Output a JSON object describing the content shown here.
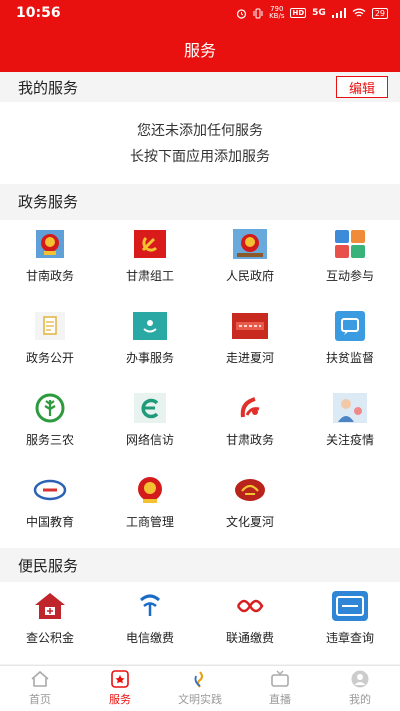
{
  "status": {
    "time": "10:56",
    "net_speed_top": "790",
    "net_speed_bottom": "KB/s",
    "hd": "HD",
    "signal": "5G",
    "battery": "29"
  },
  "header": {
    "title": "服务"
  },
  "my_services": {
    "title": "我的服务",
    "edit_label": "编辑",
    "empty_line1": "您还未添加任何服务",
    "empty_line2": "长按下面应用添加服务"
  },
  "gov_services": {
    "title": "政务服务",
    "items": [
      {
        "label": "甘南政务",
        "icon": "emblem-icon"
      },
      {
        "label": "甘肃组工",
        "icon": "party-emblem-icon"
      },
      {
        "label": "人民政府",
        "icon": "emblem-icon"
      },
      {
        "label": "互动参与",
        "icon": "grid-apps-icon"
      },
      {
        "label": "政务公开",
        "icon": "document-icon"
      },
      {
        "label": "办事服务",
        "icon": "service-icon"
      },
      {
        "label": "走进夏河",
        "icon": "banner-icon"
      },
      {
        "label": "扶贫监督",
        "icon": "chat-icon"
      },
      {
        "label": "服务三农",
        "icon": "wheat-icon"
      },
      {
        "label": "网络信访",
        "icon": "letter-e-icon"
      },
      {
        "label": "甘肃政务",
        "icon": "gansu-logo-icon"
      },
      {
        "label": "关注疫情",
        "icon": "doctor-icon"
      },
      {
        "label": "中国教育",
        "icon": "education-logo-icon"
      },
      {
        "label": "工商管理",
        "icon": "emblem-icon"
      },
      {
        "label": "文化夏河",
        "icon": "culture-logo-icon"
      }
    ]
  },
  "public_services": {
    "title": "便民服务",
    "items": [
      {
        "label": "查公积金",
        "icon": "housing-fund-icon"
      },
      {
        "label": "电信缴费",
        "icon": "china-telecom-icon"
      },
      {
        "label": "联通缴费",
        "icon": "china-unicom-icon"
      },
      {
        "label": "违章查询",
        "icon": "traffic-query-icon"
      }
    ]
  },
  "bottom_nav": [
    {
      "label": "首页",
      "icon": "home-icon",
      "active": false
    },
    {
      "label": "服务",
      "icon": "service-tab-icon",
      "active": true
    },
    {
      "label": "文明实践",
      "icon": "civilization-icon",
      "active": false
    },
    {
      "label": "直播",
      "icon": "live-tv-icon",
      "active": false
    },
    {
      "label": "我的",
      "icon": "user-icon",
      "active": false
    }
  ],
  "colors": {
    "brand": "#e8110f",
    "background": "#f4f4f4"
  }
}
